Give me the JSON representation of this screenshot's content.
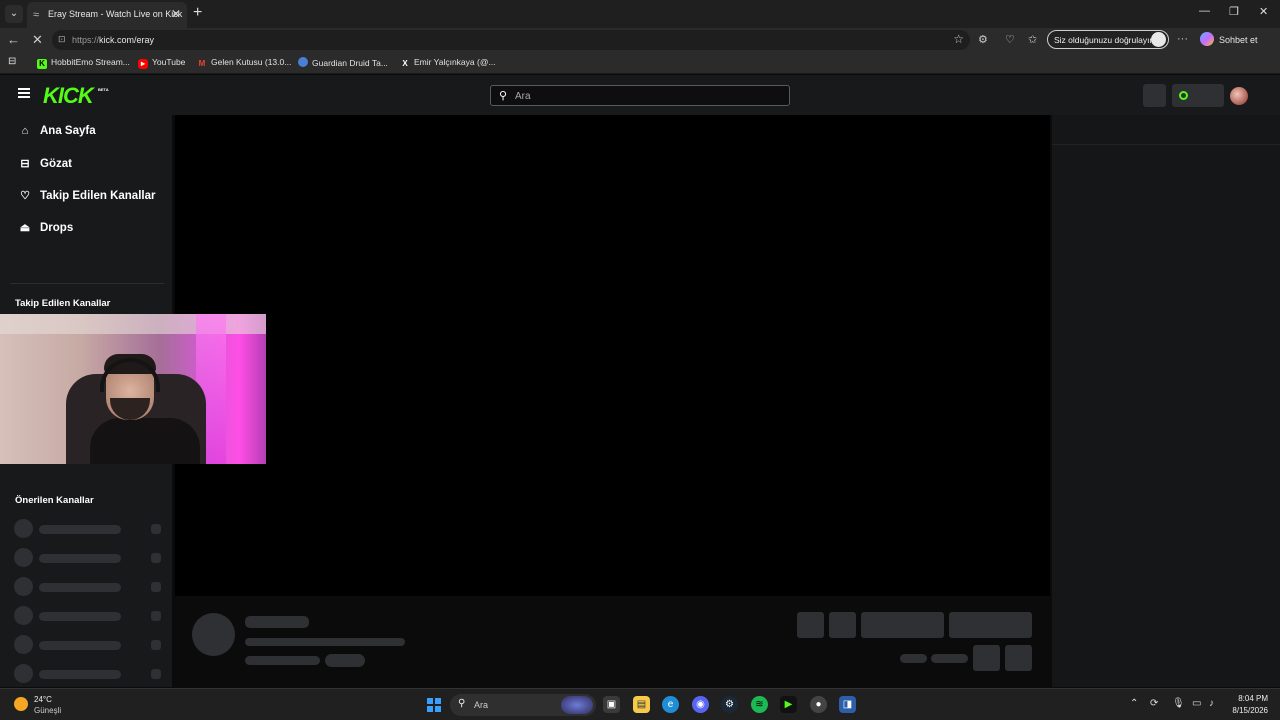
{
  "browser": {
    "tab_title": "Eray Stream - Watch Live on Kick",
    "url_prefix": "https://",
    "url_host": "kick.com/eray",
    "verify_label": "Siz olduğunuzu doğrulayın",
    "copilot_label": "Sohbet et",
    "bookmarks": [
      {
        "label": "HobbitEmo Stream...",
        "icon": "kick-icon"
      },
      {
        "label": "YouTube",
        "icon": "youtube-icon"
      },
      {
        "label": "Gelen Kutusu (13.0...",
        "icon": "gmail-icon"
      },
      {
        "label": "Guardian Druid Ta...",
        "icon": "globe-icon"
      },
      {
        "label": "Emir Yalçınkaya (@...",
        "icon": "x-icon"
      }
    ]
  },
  "kick": {
    "logo": "KICK",
    "beta": "BETA",
    "search_placeholder": "Ara",
    "nav": [
      {
        "label": "Ana Sayfa",
        "icon": "home-icon"
      },
      {
        "label": "Gözat",
        "icon": "browse-icon"
      },
      {
        "label": "Takip Edilen Kanallar",
        "icon": "heart-icon"
      },
      {
        "label": "Drops",
        "icon": "drops-icon"
      }
    ],
    "followed_heading": "Takip Edilen Kanallar",
    "recommended_heading": "Önerilen Kanallar",
    "accent": "#53fc18"
  },
  "taskbar": {
    "temperature": "24°C",
    "weather": "Güneşli",
    "search_placeholder": "Ara",
    "time": "8:04 PM",
    "date": "8/15/2026"
  }
}
